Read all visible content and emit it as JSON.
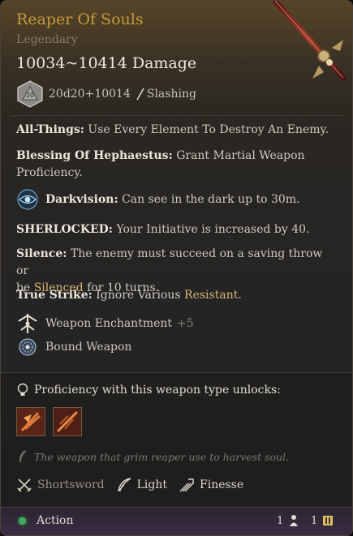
{
  "item": {
    "name": "Reaper Of Souls",
    "rarity": "Legendary",
    "damage": "10034~10414 Damage",
    "dice_formula": "20d20+10014",
    "damage_type": "Slashing",
    "dice_face": "20"
  },
  "properties": [
    {
      "name": "All-Things:",
      "text": "Use Every Element To Destroy An Enemy."
    },
    {
      "name": "Blessing Of Hephaestus:",
      "text": "Grant Martial Weapon",
      "text2": "Proficiency."
    },
    {
      "name": "Darkvision:",
      "text": "Can see in the dark up to 30m."
    },
    {
      "name": "SHERLOCKED:",
      "text": "Your Initiative is increased by 40."
    },
    {
      "name": "Silence:",
      "text": "The enemy must succeed on a saving throw or",
      "text2a": "be ",
      "text2b": "Silenced",
      "text2c": " for 10 turns."
    },
    {
      "name": "True Strike:",
      "text": "Ignore Various ",
      "text_hl": "Resistant",
      "text_end": "."
    }
  ],
  "enchantment": {
    "label": "Weapon Enchantment",
    "bonus": "+5"
  },
  "bound": {
    "label": "Bound Weapon"
  },
  "proficiency": {
    "heading": "Proficiency with this weapon type unlocks:"
  },
  "flavor": "The weapon that grim reaper use to harvest soul.",
  "weapon_props": [
    {
      "label": "Shortsword",
      "icon": "crossed-swords-icon"
    },
    {
      "label": "Light",
      "icon": "feather-icon"
    },
    {
      "label": "Finesse",
      "icon": "finesse-icon"
    }
  ],
  "footer": {
    "action_label": "Action",
    "action_cost": "1",
    "bonus_cost": "1"
  },
  "colors": {
    "title": "#c49a3c",
    "highlight": "#d9b573",
    "action_dot": "#3fae5a"
  }
}
